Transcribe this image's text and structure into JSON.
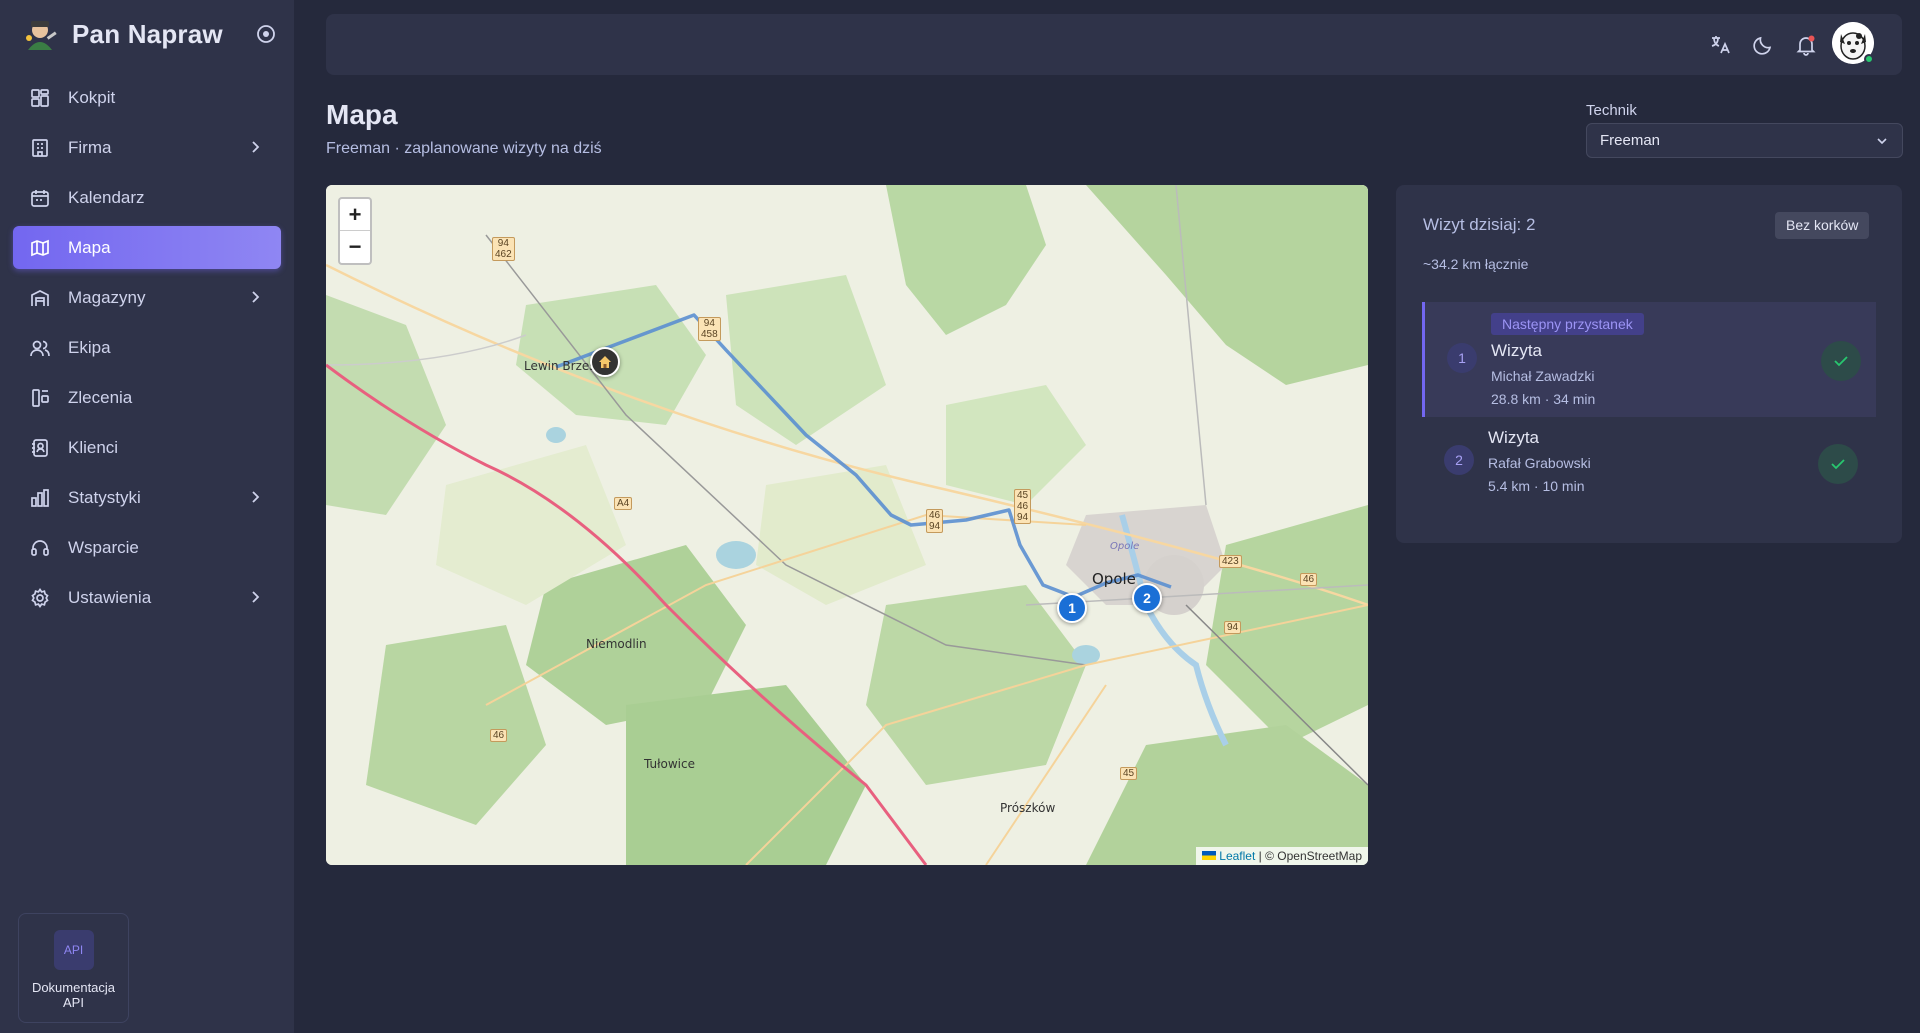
{
  "app": {
    "name": "Pan Napraw"
  },
  "sidebar": {
    "items": [
      {
        "label": "Kokpit",
        "icon": "dashboard-icon",
        "has_submenu": false,
        "active": false
      },
      {
        "label": "Firma",
        "icon": "building-icon",
        "has_submenu": true,
        "active": false
      },
      {
        "label": "Kalendarz",
        "icon": "calendar-icon",
        "has_submenu": false,
        "active": false
      },
      {
        "label": "Mapa",
        "icon": "map-icon",
        "has_submenu": false,
        "active": true
      },
      {
        "label": "Magazyny",
        "icon": "warehouse-icon",
        "has_submenu": true,
        "active": false
      },
      {
        "label": "Ekipa",
        "icon": "users-icon",
        "has_submenu": false,
        "active": false
      },
      {
        "label": "Zlecenia",
        "icon": "orders-icon",
        "has_submenu": false,
        "active": false
      },
      {
        "label": "Klienci",
        "icon": "contacts-icon",
        "has_submenu": false,
        "active": false
      },
      {
        "label": "Statystyki",
        "icon": "chart-icon",
        "has_submenu": true,
        "active": false
      },
      {
        "label": "Wsparcie",
        "icon": "headset-icon",
        "has_submenu": false,
        "active": false
      },
      {
        "label": "Ustawienia",
        "icon": "gear-icon",
        "has_submenu": true,
        "active": false
      }
    ],
    "api_box": {
      "icon_text": "API",
      "label": "Dokumentacja API"
    }
  },
  "topbar": {
    "icons": [
      "translate-icon",
      "moon-icon",
      "bell-icon"
    ],
    "notification_dot_color": "#ea5455"
  },
  "page": {
    "title": "Mapa",
    "subtitle": "Freeman · zaplanowane wizyty na dziś",
    "technician_label": "Technik",
    "technician_value": "Freeman"
  },
  "map": {
    "zoom_in": "+",
    "zoom_out": "−",
    "attribution_leaflet": "Leaflet",
    "attribution_rest": "| © OpenStreetMap",
    "markers": [
      "1",
      "2"
    ],
    "places": {
      "lewin": "Lewin Brzeski",
      "opole": "Opole",
      "opole_small": "Opole",
      "niemodlin": "Niemodlin",
      "tulowice": "Tułowice",
      "proszkow": "Prószków"
    },
    "road_signs": {
      "s1": "94\n462",
      "s2": "94\n458",
      "s3": "A4",
      "s4": "46\n94",
      "s5": "45\n46\n94",
      "s6": "423",
      "s7": "46",
      "s8": "94",
      "s9": "46",
      "s10": "45"
    },
    "route_color": "#5b8fd0",
    "highway_color": "#e8607f"
  },
  "panel": {
    "visits_title": "Wizyt dzisiaj: 2",
    "traffic_button": "Bez korków",
    "total_distance": "~34.2 km łącznie",
    "next_badge": "Następny przystanek",
    "visits": [
      {
        "num": "1",
        "title": "Wizyta",
        "client": "Michał Zawadzki",
        "details": "28.8 km · 34 min"
      },
      {
        "num": "2",
        "title": "Wizyta",
        "client": "Rafał Grabowski",
        "details": "5.4 km · 10 min"
      }
    ]
  }
}
